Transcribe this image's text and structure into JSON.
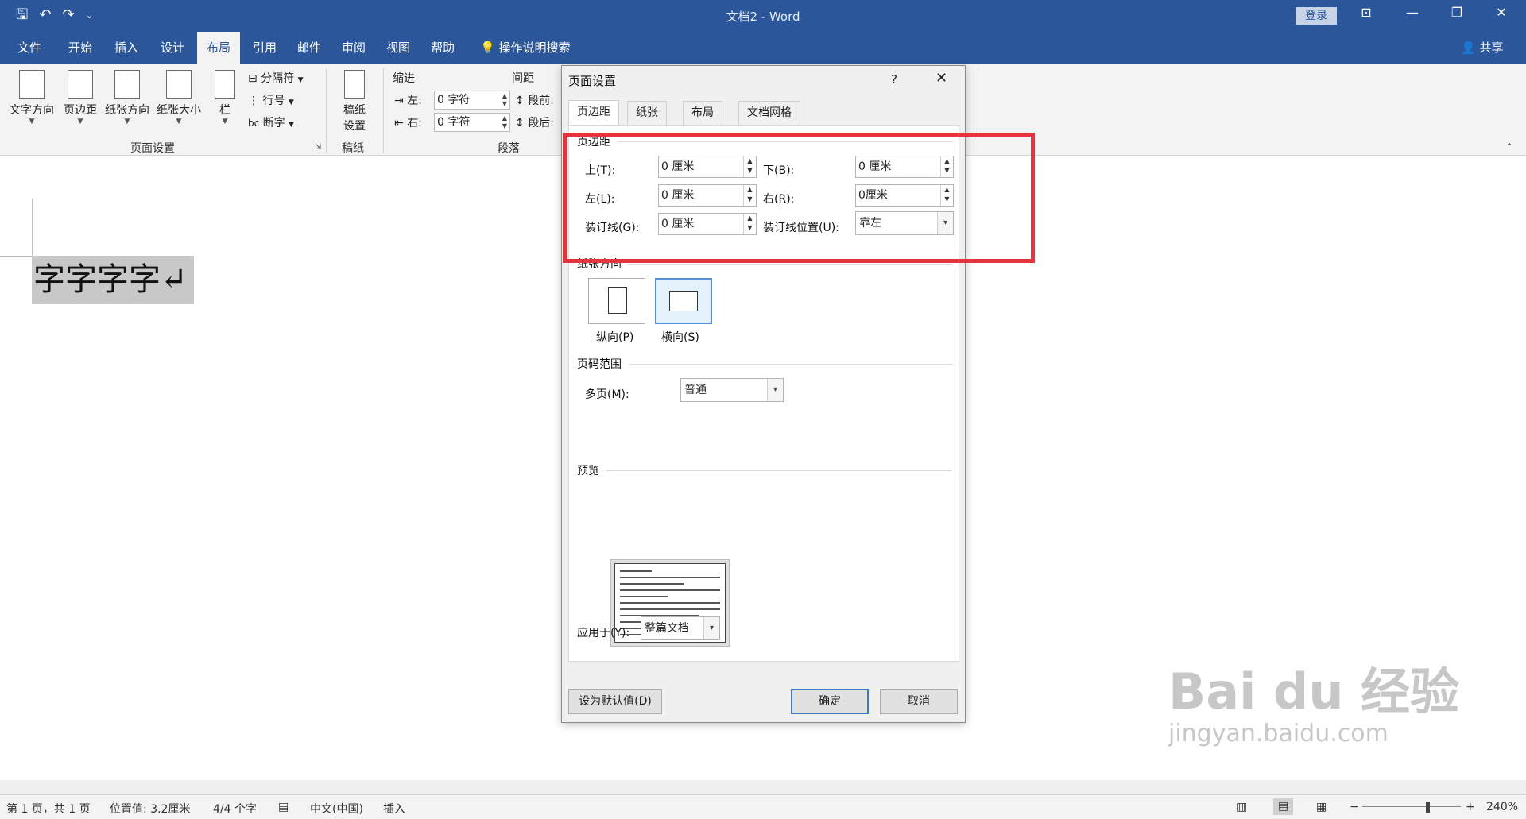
{
  "window": {
    "title": "文档2 - Word",
    "login": "登录",
    "minimize": "—",
    "restore": "❐",
    "close": "✕",
    "ribbon_display": "⊡"
  },
  "qat": {
    "save": "🖫",
    "undo": "↶",
    "redo": "↷",
    "customize": "⌄"
  },
  "tabs": [
    "文件",
    "开始",
    "插入",
    "设计",
    "布局",
    "引用",
    "邮件",
    "审阅",
    "视图",
    "帮助"
  ],
  "active_tab": "布局",
  "tell_me": "操作说明搜索",
  "share": "共享",
  "ribbon": {
    "page_setup": {
      "text_direction": "文字方向",
      "margins": "页边距",
      "orientation": "纸张方向",
      "size": "纸张大小",
      "columns": "栏",
      "breaks": "分隔符",
      "line_numbers": "行号",
      "hyphenation": "断字",
      "group_label": "页面设置"
    },
    "manuscript": {
      "button": "稿纸\n设置",
      "button_line1": "稿纸",
      "button_line2": "设置",
      "group_label": "稿纸"
    },
    "paragraph": {
      "indent_label": "缩进",
      "spacing_label": "间距",
      "left_label": "左:",
      "right_label": "右:",
      "left_value": "0 字符",
      "right_value": "0 字符",
      "before_label": "段前:",
      "after_label": "段后:",
      "group_label": "段落"
    }
  },
  "document": {
    "text": "字字字字↵"
  },
  "status": {
    "page": "第 1 页，共 1 页",
    "position": "位置值: 3.2厘米",
    "words": "4/4 个字",
    "language": "中文(中国)",
    "mode": "插入",
    "zoom": "240%",
    "zoom_minus": "−",
    "zoom_plus": "+"
  },
  "dialog": {
    "title": "页面设置",
    "help": "?",
    "close": "✕",
    "tabs": [
      "页边距",
      "纸张",
      "布局",
      "文档网格"
    ],
    "active_tab": "页边距",
    "margins_section": "页边距",
    "top_label": "上(T):",
    "top_value": "0 厘米",
    "bottom_label": "下(B):",
    "bottom_value": "0 厘米",
    "left_label": "左(L):",
    "left_value": "0 厘米",
    "right_label": "右(R):",
    "right_value": "0厘米",
    "gutter_label": "装订线(G):",
    "gutter_value": "0 厘米",
    "gutter_pos_label": "装订线位置(U):",
    "gutter_pos_value": "靠左",
    "orientation_section": "纸张方向",
    "portrait": "纵向(P)",
    "landscape": "横向(S)",
    "pages_section": "页码范围",
    "multiple_pages_label": "多页(M):",
    "multiple_pages_value": "普通",
    "preview_section": "预览",
    "apply_to_label": "应用于(Y):",
    "apply_to_value": "整篇文档",
    "set_default": "设为默认值(D)",
    "ok": "确定",
    "cancel": "取消"
  },
  "watermark": {
    "line1": "Bai du 经验",
    "line2": "jingyan.baidu.com"
  },
  "colors": {
    "accent": "#2b579a",
    "highlight_box": "#e8333d",
    "selection": "#c8c8c8"
  }
}
